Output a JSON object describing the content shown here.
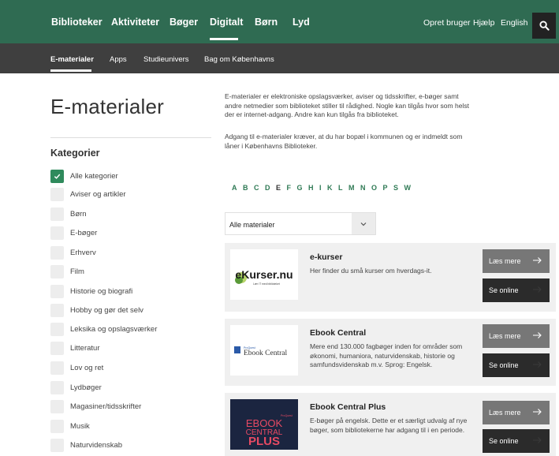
{
  "topnav": {
    "items": [
      "Biblioteker",
      "Aktiviteter",
      "Bøger",
      "Digitalt",
      "Børn",
      "Lyd"
    ],
    "links": [
      "Opret bruger",
      "Hjælp",
      "English"
    ],
    "search_icon": "search-icon"
  },
  "subnav": {
    "items": [
      "E-materialer",
      "Apps",
      "Studieunivers",
      "Bag om Københavns"
    ]
  },
  "page": {
    "title": "E-materialer",
    "intro": "E-materialer er elektroniske opslagsværker, aviser og tidsskrifter, e-bøger samt andre netmedier som biblioteket stiller til rådighed. Nogle kan tilgås hvor som helst der er internet-adgang. Andre kan kun tilgås fra biblioteket.",
    "intro2": "Adgang til e-materialer kræver, at du har bopæl i kommunen og er indmeldt som låner i Københavns Biblioteker."
  },
  "categories": {
    "heading": "Kategorier",
    "items": [
      "Alle kategorier",
      "Aviser og artikler",
      "Børn",
      "E-bøger",
      "Erhverv",
      "Film",
      "Historie og biografi",
      "Hobby og gør det selv",
      "Leksika og opslagsværker",
      "Litteratur",
      "Lov og ret",
      "Lydbøger",
      "Magasiner/tidsskrifter",
      "Musik",
      "Naturvidenskab"
    ]
  },
  "alphabet": [
    "A",
    "B",
    "C",
    "D",
    "E",
    "F",
    "G",
    "H",
    "I",
    "K",
    "L",
    "M",
    "N",
    "O",
    "P",
    "S",
    "W"
  ],
  "filter": {
    "selected": "Alle materialer"
  },
  "buttons": {
    "read_more": "Læs mere",
    "online": "Se online"
  },
  "cards": [
    {
      "title": "e-kurser",
      "desc": "Her finder du små kurser om hverdags-it.",
      "logo_text": "eKurser.nu",
      "logo_sub": "Lær IT med biblioteket"
    },
    {
      "title": "Ebook Central",
      "desc": "Mere end 130.000 fagbøger inden for områder som økonomi, humaniora, naturvidenskab, historie og samfundsvidenskab m.v. Sprog: Engelsk.",
      "logo_small": "ProQuest",
      "logo_text": "Ebook Central"
    },
    {
      "title": "Ebook Central Plus",
      "desc": "E-bøger på engelsk. Dette er et særligt udvalg af nye bøger, som bibliotekerne har adgang til i en periode.",
      "logo_small": "ProQuest",
      "logo_l1": "EBOOK",
      "logo_l2": "CENTRAL",
      "logo_l3": "PLUS"
    }
  ],
  "colors": {
    "green": "#2f6b52",
    "subnav": "#3f3f3f",
    "accent": "#2f7a55"
  }
}
